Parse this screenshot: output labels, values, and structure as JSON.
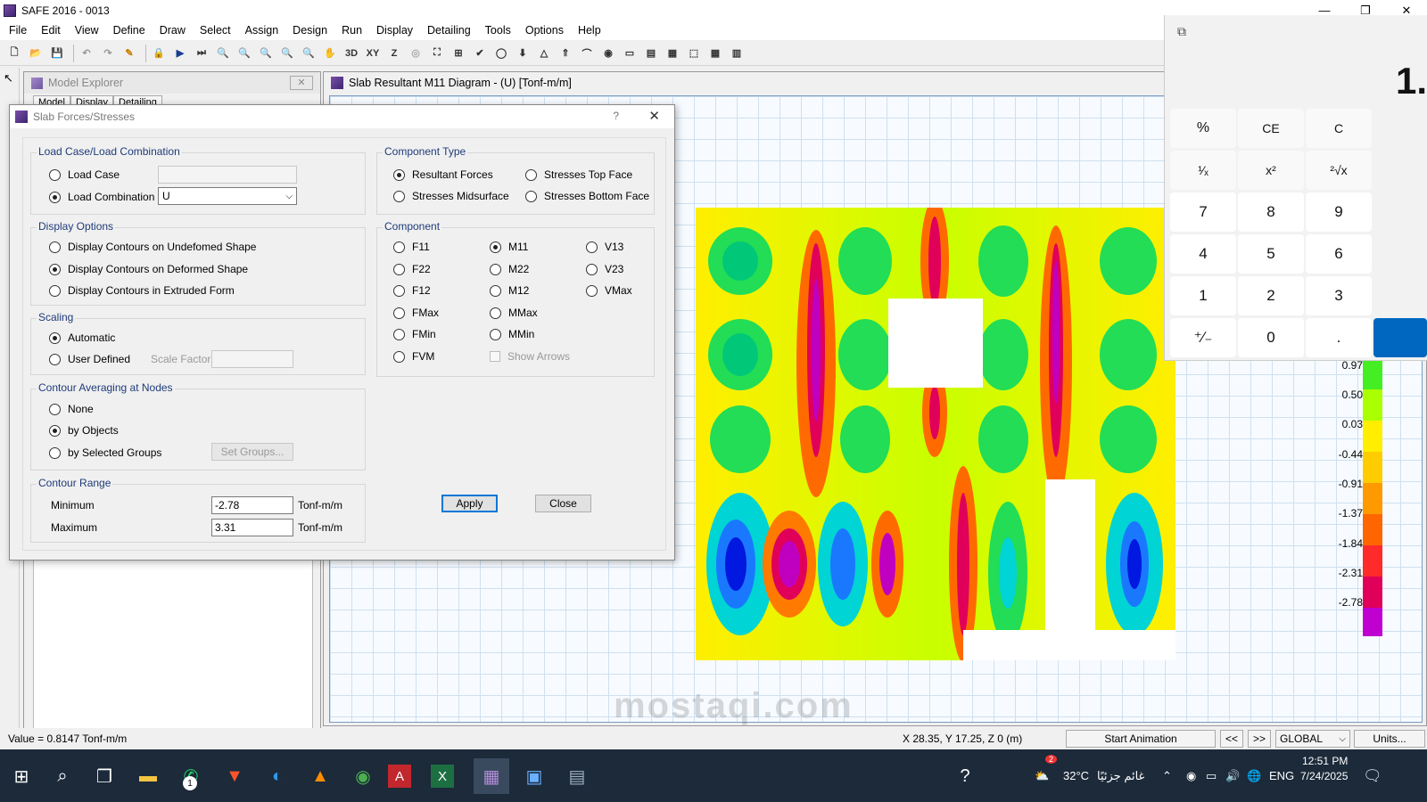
{
  "app": {
    "title": "SAFE 2016 - 0013"
  },
  "window_controls": [
    "—",
    "❐",
    "✕"
  ],
  "menu": [
    "File",
    "Edit",
    "View",
    "Define",
    "Draw",
    "Select",
    "Assign",
    "Design",
    "Run",
    "Display",
    "Detailing",
    "Tools",
    "Options",
    "Help"
  ],
  "toolbar": [
    "3D",
    "XY",
    "Z"
  ],
  "explorer": {
    "title": "Model Explorer",
    "tabs": [
      "Model",
      "Display",
      "Detailing"
    ]
  },
  "diagram": {
    "title": "Slab Resultant M11 Diagram - (U)  [Tonf-m/m]"
  },
  "dialog": {
    "title": "Slab Forces/Stresses",
    "help": "?",
    "close_glyph": "✕",
    "load_group": {
      "title": "Load Case/Load Combination",
      "load_case": "Load Case",
      "load_combination": "Load Combination",
      "combo_value": "U"
    },
    "component_type": {
      "title": "Component Type",
      "resultant_forces": "Resultant Forces",
      "stresses_top": "Stresses Top Face",
      "stresses_mid": "Stresses Midsurface",
      "stresses_bottom": "Stresses Bottom Face"
    },
    "display_options": {
      "title": "Display Options",
      "undeformed": "Display Contours on Undefomed Shape",
      "deformed": "Display Contours on Deformed Shape",
      "extruded": "Display Contours in Extruded Form"
    },
    "component": {
      "title": "Component",
      "items": [
        "F11",
        "M11",
        "V13",
        "F22",
        "M22",
        "V23",
        "F12",
        "M12",
        "VMax",
        "FMax",
        "MMax",
        "FMin",
        "MMin",
        "FVM"
      ],
      "show_arrows": "Show Arrows"
    },
    "scaling": {
      "title": "Scaling",
      "automatic": "Automatic",
      "user_defined": "User Defined",
      "scale_factor": "Scale Factor"
    },
    "averaging": {
      "title": "Contour Averaging at Nodes",
      "none": "None",
      "by_objects": "by Objects",
      "by_groups": "by Selected Groups",
      "set_groups": "Set Groups..."
    },
    "range": {
      "title": "Contour Range",
      "minimum": "Minimum",
      "min_value": "-2.78",
      "maximum": "Maximum",
      "max_value": "3.31",
      "unit": "Tonf-m/m"
    },
    "apply": "Apply",
    "close": "Close"
  },
  "legend": [
    "0.97",
    "0.50",
    "0.03",
    "-0.44",
    "-0.91",
    "-1.37",
    "-1.84",
    "-2.31",
    "-2.78"
  ],
  "calculator": {
    "display": "1.",
    "restore_icon": "⧉",
    "keys": [
      "%",
      "CE",
      "C",
      "¹⁄ₓ",
      "x²",
      "²√x",
      "7",
      "8",
      "9",
      "4",
      "5",
      "6",
      "1",
      "2",
      "3",
      "⁺∕₋",
      "0",
      "."
    ]
  },
  "status": {
    "value": "Value = 0.8147 Tonf-m/m",
    "coords": "X 28.35,  Y 17.25,  Z 0  (m)",
    "start_animation": "Start Animation",
    "prev": "<<",
    "next": ">>",
    "system": "GLOBAL",
    "units": "Units..."
  },
  "taskbar": {
    "temperature": "32°C",
    "weather": "غائم جزئيًا",
    "lang": "ENG",
    "time": "12:51 PM",
    "date": "7/24/2025",
    "weather_badge": "2",
    "whatsapp_badge": "1"
  },
  "watermark": "mostaqi.com"
}
